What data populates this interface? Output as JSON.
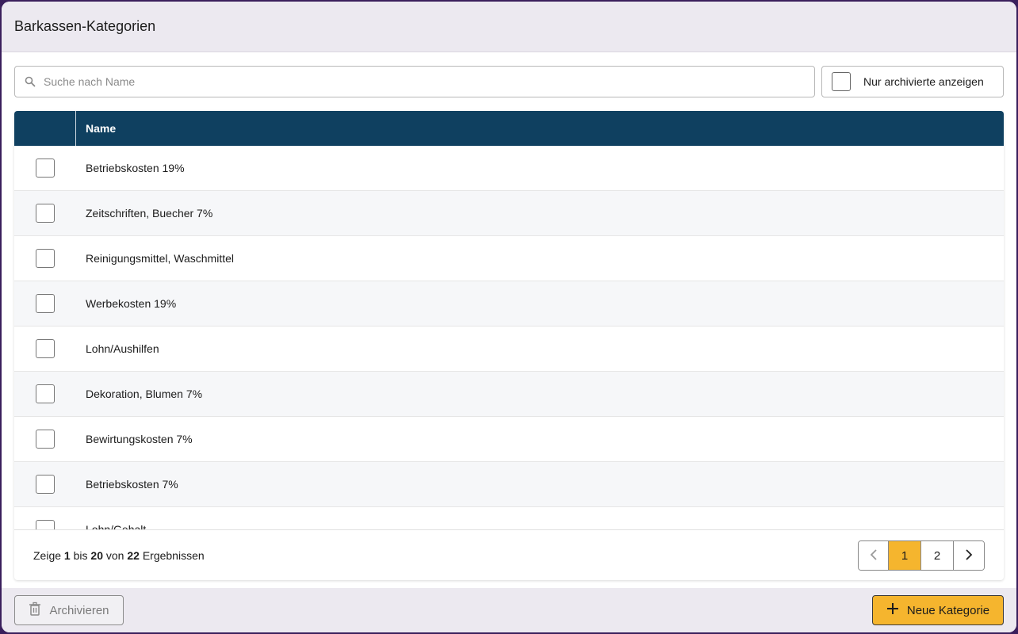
{
  "header": {
    "title": "Barkassen-Kategorien"
  },
  "search": {
    "placeholder": "Suche nach Name",
    "value": ""
  },
  "filter": {
    "archived_label": "Nur archivierte anzeigen",
    "checked": false
  },
  "table": {
    "columns": [
      "",
      "Name"
    ],
    "rows": [
      {
        "name": "Betriebskosten 19%"
      },
      {
        "name": "Zeitschriften, Buecher 7%"
      },
      {
        "name": "Reinigungsmittel, Waschmittel"
      },
      {
        "name": "Werbekosten 19%"
      },
      {
        "name": "Lohn/Aushilfen"
      },
      {
        "name": "Dekoration, Blumen 7%"
      },
      {
        "name": "Bewirtungskosten 7%"
      },
      {
        "name": "Betriebskosten 7%"
      },
      {
        "name": "Lohn/Gehalt"
      }
    ]
  },
  "pagination": {
    "prefix": "Zeige",
    "from": "1",
    "mid1": "bis",
    "to": "20",
    "mid2": "von",
    "total": "22",
    "suffix": "Ergebnissen",
    "pages": [
      "1",
      "2"
    ],
    "current_page": "1"
  },
  "actions": {
    "archive_label": "Archivieren",
    "new_label": "Neue Kategorie"
  },
  "colors": {
    "header_bg": "#0f4060",
    "accent": "#f5b52e",
    "frame": "#3a1f5c"
  },
  "icons": {
    "search": "search-icon",
    "prev": "chevron-left-icon",
    "next": "chevron-right-icon",
    "archive": "trash-icon",
    "add": "plus-icon"
  }
}
